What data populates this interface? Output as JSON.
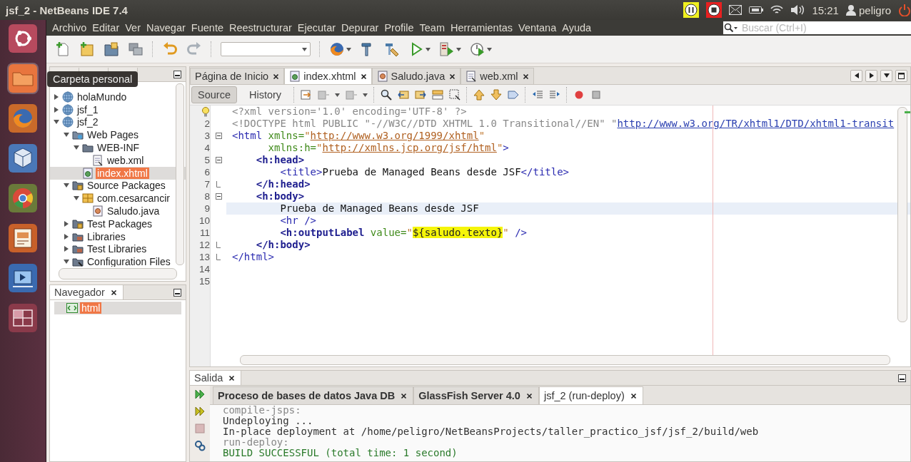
{
  "window": {
    "title": "jsf_2 - NetBeans IDE 7.4"
  },
  "tray": {
    "clock": "15:21",
    "user": "peligro"
  },
  "launcher": {
    "tooltip": "Carpeta personal",
    "items": [
      {
        "kind": "ubuntu",
        "selected": false
      },
      {
        "kind": "folder",
        "selected": true
      },
      {
        "kind": "firefox",
        "selected": false
      },
      {
        "kind": "box",
        "selected": false
      },
      {
        "kind": "chrome",
        "selected": false
      },
      {
        "kind": "slides",
        "selected": false
      },
      {
        "kind": "video",
        "selected": false
      },
      {
        "kind": "workspaces",
        "selected": false
      }
    ]
  },
  "menu": [
    "Archivo",
    "Editar",
    "Ver",
    "Navegar",
    "Fuente",
    "Reestructurar",
    "Ejecutar",
    "Depurar",
    "Profile",
    "Team",
    "Herramientas",
    "Ventana",
    "Ayuda"
  ],
  "search": {
    "placeholder": "Buscar (Ctrl+I)"
  },
  "projects": {
    "tree": [
      {
        "label": "holaMundo",
        "kind": "project",
        "expanded": false,
        "selected": false
      },
      {
        "label": "jsf_1",
        "kind": "project",
        "expanded": false,
        "selected": false
      },
      {
        "label": "jsf_2",
        "kind": "project",
        "expanded": true,
        "selected": false,
        "children": [
          {
            "label": "Web Pages",
            "kind": "webpages",
            "expanded": true,
            "selected": false,
            "children": [
              {
                "label": "WEB-INF",
                "kind": "folder",
                "expanded": true,
                "selected": false,
                "children": [
                  {
                    "label": "web.xml",
                    "kind": "xml",
                    "selected": false
                  }
                ]
              },
              {
                "label": "index.xhtml",
                "kind": "xhtml",
                "selected": true
              }
            ]
          },
          {
            "label": "Source Packages",
            "kind": "srcpkg",
            "expanded": true,
            "selected": false,
            "children": [
              {
                "label": "com.cesarcancir",
                "kind": "package",
                "expanded": true,
                "selected": false,
                "children": [
                  {
                    "label": "Saludo.java",
                    "kind": "java",
                    "selected": false
                  }
                ]
              }
            ]
          },
          {
            "label": "Test Packages",
            "kind": "srcpkg",
            "expanded": false,
            "selected": false
          },
          {
            "label": "Libraries",
            "kind": "libs",
            "expanded": false,
            "selected": false
          },
          {
            "label": "Test Libraries",
            "kind": "libs",
            "expanded": false,
            "selected": false
          },
          {
            "label": "Configuration Files",
            "kind": "config",
            "expanded": true,
            "selected": false
          }
        ]
      }
    ]
  },
  "navigator": {
    "title": "Navegador",
    "tree": [
      {
        "label": "html",
        "kind": "html",
        "selected": true
      }
    ]
  },
  "editor": {
    "tabs": [
      {
        "label": "Página de Inicio",
        "kind": "page",
        "selected": false
      },
      {
        "label": "index.xhtml",
        "kind": "xhtml",
        "selected": true
      },
      {
        "label": "Saludo.java",
        "kind": "java",
        "selected": false
      },
      {
        "label": "web.xml",
        "kind": "xml",
        "selected": false
      }
    ],
    "views": [
      {
        "label": "Source",
        "selected": true
      },
      {
        "label": "History",
        "selected": false
      }
    ],
    "lines": [
      {
        "kind": "plain",
        "hint": true,
        "current": false,
        "segments": [
          {
            "kind": "decl",
            "text": "<?xml version='1.0' encoding='UTF-8' ?>"
          }
        ]
      },
      {
        "kind": "plain",
        "number": "2",
        "current": false,
        "segments": [
          {
            "kind": "decl",
            "text": "<!DOCTYPE html PUBLIC \"-//W3C//DTD XHTML 1.0 Transitional//EN\" \""
          },
          {
            "kind": "link",
            "text": "http://www.w3.org/TR/xhtml1/DTD/xhtml1-transit"
          }
        ]
      },
      {
        "kind": "fold_start",
        "number": "3",
        "current": false,
        "segments": [
          {
            "kind": "tag",
            "text": "<html"
          },
          {
            "kind": "attr",
            "text": " xmlns="
          },
          {
            "kind": "str",
            "text": "\""
          },
          {
            "kind": "url",
            "text": "http://www.w3.org/1999/xhtml"
          },
          {
            "kind": "str",
            "text": "\""
          }
        ]
      },
      {
        "kind": "plain",
        "number": "4",
        "current": false,
        "segments": [
          {
            "kind": "attr",
            "text": "      xmlns:h="
          },
          {
            "kind": "str",
            "text": "\""
          },
          {
            "kind": "url",
            "text": "http://xmlns.jcp.org/jsf/html"
          },
          {
            "kind": "str",
            "text": "\""
          },
          {
            "kind": "tag",
            "text": ">"
          }
        ]
      },
      {
        "kind": "fold_start",
        "number": "5",
        "current": false,
        "segments": [
          {
            "kind": "btag",
            "text": "    <h:head>"
          }
        ]
      },
      {
        "kind": "plain",
        "number": "6",
        "current": false,
        "segments": [
          {
            "kind": "tag",
            "text": "        <title>"
          },
          {
            "kind": "text",
            "text": "Prueba de Managed Beans desde JSF"
          },
          {
            "kind": "tag",
            "text": "</title>"
          }
        ]
      },
      {
        "kind": "fold_end",
        "number": "7",
        "current": false,
        "segments": [
          {
            "kind": "btag",
            "text": "    </h:head>"
          }
        ]
      },
      {
        "kind": "fold_start",
        "number": "8",
        "current": false,
        "segments": [
          {
            "kind": "btag",
            "text": "    <h:body>"
          }
        ]
      },
      {
        "kind": "plain",
        "number": "9",
        "current": true,
        "segments": [
          {
            "kind": "text",
            "text": "        Prueba de Managed Beans desde JSF"
          }
        ]
      },
      {
        "kind": "plain",
        "number": "10",
        "current": false,
        "segments": [
          {
            "kind": "tag",
            "text": "        <hr />"
          }
        ]
      },
      {
        "kind": "plain",
        "number": "11",
        "current": false,
        "segments": [
          {
            "kind": "btag",
            "text": "        <h:outputLabel"
          },
          {
            "kind": "attr",
            "text": " value="
          },
          {
            "kind": "str",
            "text": "\""
          },
          {
            "kind": "mark",
            "text": "${saludo.texto}"
          },
          {
            "kind": "str",
            "text": "\""
          },
          {
            "kind": "tag",
            "text": " />"
          }
        ]
      },
      {
        "kind": "fold_end",
        "number": "12",
        "current": false,
        "segments": [
          {
            "kind": "btag",
            "text": "    </h:body>"
          }
        ]
      },
      {
        "kind": "fold_end",
        "number": "13",
        "current": false,
        "segments": [
          {
            "kind": "tag",
            "text": "</html>"
          }
        ]
      },
      {
        "kind": "plain",
        "number": "14",
        "current": false
      },
      {
        "kind": "plain",
        "number": "15",
        "current": false
      }
    ]
  },
  "output": {
    "title": "Salida",
    "tabs": [
      {
        "label": "Proceso de bases de datos Java DB",
        "selected": false
      },
      {
        "label": "GlassFish Server 4.0",
        "selected": false
      },
      {
        "label": "jsf_2 (run-deploy)",
        "selected": true
      }
    ],
    "lines": [
      {
        "kind": "target",
        "text": "compile-jsps:"
      },
      {
        "kind": "message",
        "text": "Undeploying ..."
      },
      {
        "kind": "message",
        "text": "In-place deployment at /home/peligro/NetBeansProjects/taller_practico_jsf/jsf_2/build/web"
      },
      {
        "kind": "target",
        "text": "run-deploy:"
      },
      {
        "kind": "success",
        "text": "BUILD SUCCESSFUL (total time: 1 second)"
      }
    ]
  }
}
